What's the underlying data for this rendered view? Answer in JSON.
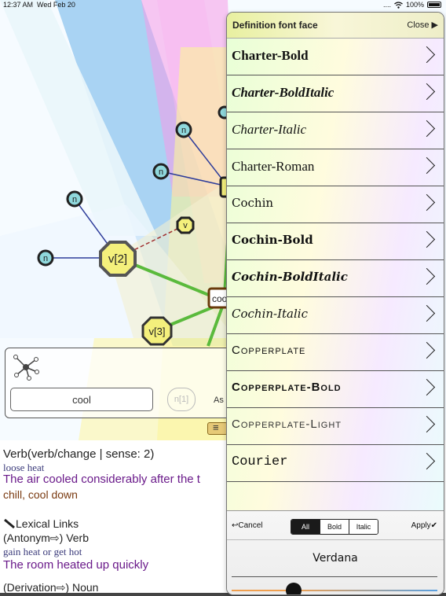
{
  "status_bar": {
    "time": "12:37 AM",
    "date": "Wed Feb 20",
    "signal": "....",
    "wifi_icon": "wifi-icon",
    "battery": "100%"
  },
  "graph": {
    "nodes": {
      "n1": "n",
      "n2": "n",
      "n3": "n",
      "n4": "n",
      "v_small": "v",
      "v2": "v[2]",
      "v3": "v[3]",
      "center": "coo",
      "right_partial": "c"
    },
    "colors": {
      "n_fill": "#8fd8dc",
      "v_fill": "#f4f07c",
      "edge_green": "#5aba3c",
      "edge_blue": "#2d3c9a",
      "edge_red": "#a03030"
    }
  },
  "search": {
    "graph_icon": "graph-network-icon",
    "value": "cool",
    "ghost_node": "n[1]",
    "partial_label": "As"
  },
  "definition": {
    "header": "Verb(verb/change | sense: 2)",
    "gloss": "loose heat",
    "example": "The air cooled considerably after the t",
    "synonyms": "chill, cool down",
    "lexical_links_label": "Lexical Links",
    "lexical_links_icon": "pencil-icon",
    "antonym_header": "(Antonym⇨) Verb",
    "antonym_gloss": "gain heat or get hot",
    "antonym_example": "The room heated up quickly",
    "derivation_header": "(Derivation⇨) Noun"
  },
  "font_panel": {
    "title": "Definition font face",
    "close_label": "Close ▶",
    "fonts": [
      {
        "label": "Charter-Bold"
      },
      {
        "label": "Charter-BoldItalic"
      },
      {
        "label": "Charter-Italic"
      },
      {
        "label": "Charter-Roman"
      },
      {
        "label": "Cochin"
      },
      {
        "label": "Cochin-Bold"
      },
      {
        "label": "Cochin-BoldItalic"
      },
      {
        "label": "Cochin-Italic"
      },
      {
        "label": "Copperplate"
      },
      {
        "label": "Copperplate-Bold"
      },
      {
        "label": "Copperplate-Light"
      },
      {
        "label": "Courier"
      }
    ],
    "cancel_label": "↩Cancel",
    "apply_label": "Apply✔",
    "filter": {
      "all": "All",
      "bold": "Bold",
      "italic": "Italic",
      "selected": "All"
    },
    "selected_font": "Verdana",
    "size_level": 0.3
  }
}
